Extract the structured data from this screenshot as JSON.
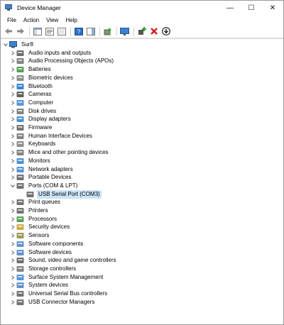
{
  "window": {
    "title": "Device Manager",
    "minimize": "—",
    "maximize": "☐",
    "close": "✕"
  },
  "menu": [
    "File",
    "Action",
    "View",
    "Help"
  ],
  "tree": {
    "root": "Sur8",
    "categories": [
      {
        "label": "Audio inputs and outputs",
        "icon": "speaker-icon",
        "color": "#555555"
      },
      {
        "label": "Audio Processing Objects (APOs)",
        "icon": "audio-processing-icon",
        "color": "#6a6a6a"
      },
      {
        "label": "Batteries",
        "icon": "battery-icon",
        "color": "#3c8f3c"
      },
      {
        "label": "Biometric devices",
        "icon": "fingerprint-icon",
        "color": "#7a7a7a"
      },
      {
        "label": "Bluetooth",
        "icon": "bluetooth-icon",
        "color": "#1a6fd1"
      },
      {
        "label": "Cameras",
        "icon": "camera-icon",
        "color": "#444444"
      },
      {
        "label": "Computer",
        "icon": "computer-icon",
        "color": "#3a82d1"
      },
      {
        "label": "Disk drives",
        "icon": "disk-drive-icon",
        "color": "#6d6d6d"
      },
      {
        "label": "Display adapters",
        "icon": "display-adapter-icon",
        "color": "#2e7fc8"
      },
      {
        "label": "Firmware",
        "icon": "firmware-icon",
        "color": "#5f5f5f"
      },
      {
        "label": "Human Interface Devices",
        "icon": "hid-icon",
        "color": "#6e6e6e"
      },
      {
        "label": "Keyboards",
        "icon": "keyboard-icon",
        "color": "#7a7a7a"
      },
      {
        "label": "Mice and other pointing devices",
        "icon": "mouse-icon",
        "color": "#6c6c6c"
      },
      {
        "label": "Monitors",
        "icon": "monitor-icon",
        "color": "#2e7fc8"
      },
      {
        "label": "Network adapters",
        "icon": "network-adapter-icon",
        "color": "#3a82d1"
      },
      {
        "label": "Portable Devices",
        "icon": "portable-device-icon",
        "color": "#5a5a5a"
      },
      {
        "label": "Ports (COM & LPT)",
        "icon": "port-icon",
        "color": "#5a5a5a",
        "expanded": true,
        "children": [
          {
            "label": "USB Serial Port (COM3)",
            "icon": "serial-port-icon",
            "color": "#5a5a5a"
          }
        ]
      },
      {
        "label": "Print queues",
        "icon": "print-queue-icon",
        "color": "#5a5a5a"
      },
      {
        "label": "Printers",
        "icon": "printer-icon",
        "color": "#5a5a5a"
      },
      {
        "label": "Processors",
        "icon": "processor-icon",
        "color": "#3c8f3c"
      },
      {
        "label": "Security devices",
        "icon": "security-device-icon",
        "color": "#c89b2a"
      },
      {
        "label": "Sensors",
        "icon": "sensor-icon",
        "color": "#8a8a3a"
      },
      {
        "label": "Software components",
        "icon": "software-component-icon",
        "color": "#4a7fc1"
      },
      {
        "label": "Software devices",
        "icon": "software-device-icon",
        "color": "#4a7fc1"
      },
      {
        "label": "Sound, video and game controllers",
        "icon": "sound-controller-icon",
        "color": "#555555"
      },
      {
        "label": "Storage controllers",
        "icon": "storage-controller-icon",
        "color": "#6d6d6d"
      },
      {
        "label": "Surface System Management",
        "icon": "surface-icon",
        "color": "#3a82d1"
      },
      {
        "label": "System devices",
        "icon": "system-device-icon",
        "color": "#4a7fc1"
      },
      {
        "label": "Universal Serial Bus controllers",
        "icon": "usb-controller-icon",
        "color": "#5a5a5a"
      },
      {
        "label": "USB Connector Managers",
        "icon": "usb-connector-icon",
        "color": "#5a5a5a"
      }
    ]
  }
}
